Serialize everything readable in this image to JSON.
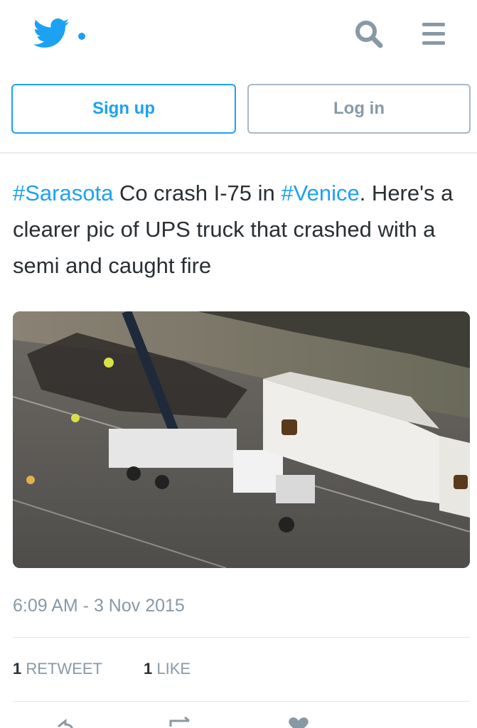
{
  "header": {
    "logo_icon": "twitter-bird-icon",
    "search_icon": "search-icon",
    "menu_icon": "hamburger-menu-icon",
    "brand_color": "#1da1f2"
  },
  "auth": {
    "signup_label": "Sign up",
    "login_label": "Log in"
  },
  "tweet": {
    "text_parts": [
      {
        "text": "#Sarasota",
        "hashtag": true
      },
      {
        "text": " Co crash I-75 in ",
        "hashtag": false
      },
      {
        "text": "#Venice",
        "hashtag": true
      },
      {
        "text": ". Here's a clearer pic of UPS truck that crashed with a semi and caught fire",
        "hashtag": false
      }
    ],
    "media_icon": "photo-of-ups-truck-crash",
    "timestamp": "6:09 AM - 3 Nov 2015",
    "stats": {
      "retweet_count": "1",
      "retweet_label": "RETWEET",
      "like_count": "1",
      "like_label": "LIKE"
    },
    "actions": {
      "reply_icon": "reply-icon",
      "retweet_icon": "retweet-icon",
      "like_icon": "heart-icon"
    }
  }
}
